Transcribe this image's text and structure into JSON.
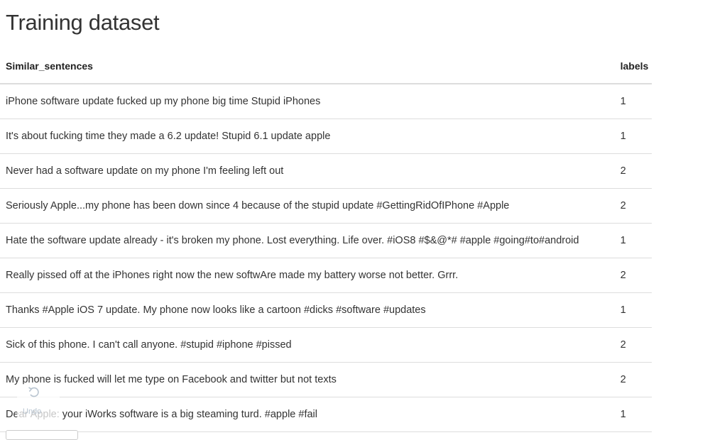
{
  "page": {
    "title": "Training dataset"
  },
  "table": {
    "columns": [
      "Similar_sentences",
      "labels"
    ],
    "rows": [
      {
        "text": "iPhone software update fucked up my phone big time Stupid iPhones",
        "label": "1"
      },
      {
        "text": "It's about fucking time they made a 6.2 update! Stupid 6.1 update apple",
        "label": "1"
      },
      {
        "text": "Never had a software update on my phone I'm feeling left out",
        "label": "2"
      },
      {
        "text": "Seriously Apple...my phone has been down since 4 because of the stupid update #GettingRidOfIPhone #Apple",
        "label": "2"
      },
      {
        "text": "Hate the software update already - it's broken my phone. Lost everything. Life over. #iOS8 #$&@*# #apple #going#to#android",
        "label": "1"
      },
      {
        "text": "Really pissed off at the iPhones right now the new softwAre made my battery worse not better. Grrr.",
        "label": "2"
      },
      {
        "text": "Thanks #Apple iOS 7 update. My phone now looks like a cartoon #dicks #software #updates",
        "label": "1"
      },
      {
        "text": "Sick of this phone. I can't call anyone. #stupid #iphone #pissed",
        "label": "2"
      },
      {
        "text": "My phone is fucked will let me type on Facebook and twitter but not texts",
        "label": "2"
      },
      {
        "text": "Dear Apple: your iWorks software is a big steaming turd. #apple #fail",
        "label": "1"
      }
    ]
  },
  "undo": {
    "label": "Undo",
    "icon": "undo-icon"
  }
}
